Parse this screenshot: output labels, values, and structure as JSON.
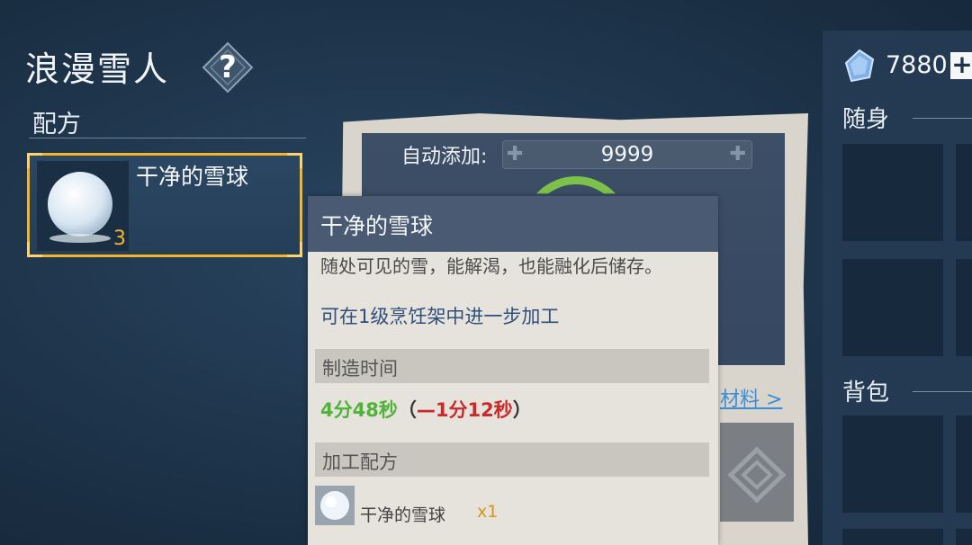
{
  "page": {
    "title": "浪漫雪人"
  },
  "left_panel": {
    "header": "配方",
    "selected_recipe": {
      "name": "干净的雪球",
      "count": "3",
      "icon": "snowball-icon"
    }
  },
  "crafting": {
    "auto_add_label": "自动添加:",
    "auto_add_value": "9999",
    "materials_link": "材料 >"
  },
  "tooltip": {
    "title": "干净的雪球",
    "description": "随处可见的雪，能解渴，也能融化后储存。",
    "description_hint": "可在1级烹饪架中进一步加工",
    "section_time": "制造时间",
    "time": "4分48秒",
    "time_open": "（",
    "time_reduction": "—1分12秒",
    "time_close": "）",
    "section_recipe": "加工配方",
    "ingredient": {
      "name": "干净的雪球",
      "qty": "x1",
      "icon": "snowball-icon"
    }
  },
  "right_panel": {
    "currency_amount": "7880",
    "currency_icon": "crystal-gem-icon",
    "currency_add": "+",
    "carry_label": "随身",
    "backpack_label": "背包"
  },
  "colors": {
    "highlight": "#f4b629",
    "time_green": "#4fb338",
    "reduction_red": "#c92a2a",
    "link_blue": "#3a8ed8"
  }
}
